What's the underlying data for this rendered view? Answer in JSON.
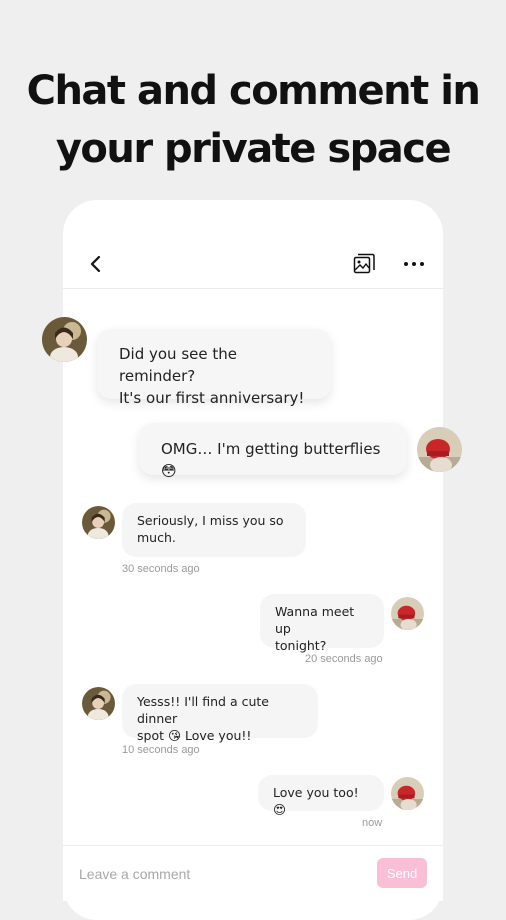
{
  "headline": {
    "line1": "Chat and comment in",
    "line2": "your private space"
  },
  "header": {
    "back_icon": "chevron-left-icon",
    "gallery_icon": "photo-gallery-icon",
    "more_icon": "more-horizontal-icon"
  },
  "messages": [
    {
      "sender": "partner",
      "line1": "Did you see the reminder?",
      "line2": "It's our first anniversary!"
    },
    {
      "sender": "me",
      "text": "OMG… I'm getting butterflies 😳"
    },
    {
      "sender": "partner",
      "line1": "Seriously, I miss you so",
      "line2": "much.",
      "time": "30 seconds ago"
    },
    {
      "sender": "me",
      "line1": "Wanna meet up",
      "line2": "tonight?",
      "time": "20 seconds ago"
    },
    {
      "sender": "partner",
      "line1": "Yesss!! I'll find a cute dinner",
      "line2": "spot 😘 Love you!!",
      "time": "10 seconds ago"
    },
    {
      "sender": "me",
      "text": "Love you too! 😍",
      "time": "now"
    }
  ],
  "composer": {
    "placeholder": "Leave a comment",
    "send_label": "Send"
  },
  "colors": {
    "background": "#efefef",
    "bubble": "#f5f5f5",
    "send_button": "#f8bfd6"
  }
}
